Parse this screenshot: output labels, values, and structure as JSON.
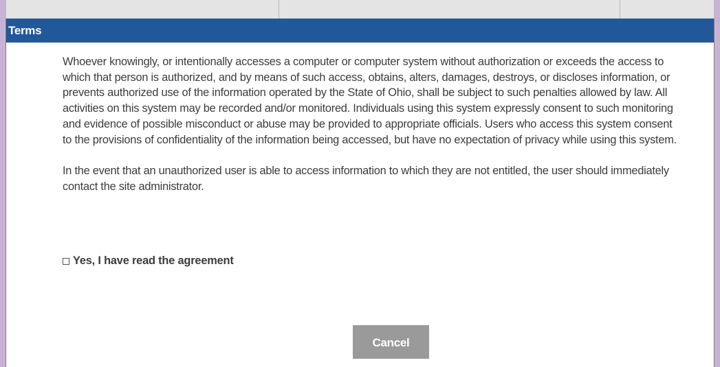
{
  "dialog": {
    "title": "Terms",
    "paragraph_1": "Whoever knowingly, or intentionally accesses a computer or computer system without authorization or exceeds the access to which that person is authorized, and by means of such access, obtains, alters, damages, destroys, or discloses information, or prevents authorized use of the information operated by the State of Ohio, shall be subject to such penalties allowed by law. All activities on this system may be recorded and/or monitored. Individuals using this system expressly consent to such monitoring and evidence of possible misconduct or abuse may be provided to appropriate officials. Users who access this system consent to the provisions of confidentiality of the information being accessed, but have no expectation of privacy while using this system.",
    "paragraph_2": "In the event that an unauthorized user is able to access information to which they are not entitled, the user should immediately contact the site administrator.",
    "agreement_label": "Yes, I have read the agreement",
    "agreement_checked": false,
    "cancel_label": "Cancel"
  },
  "colors": {
    "titlebar": "#21589a",
    "backdrop": "#c8b3d6",
    "button": "#9a9a9a"
  }
}
